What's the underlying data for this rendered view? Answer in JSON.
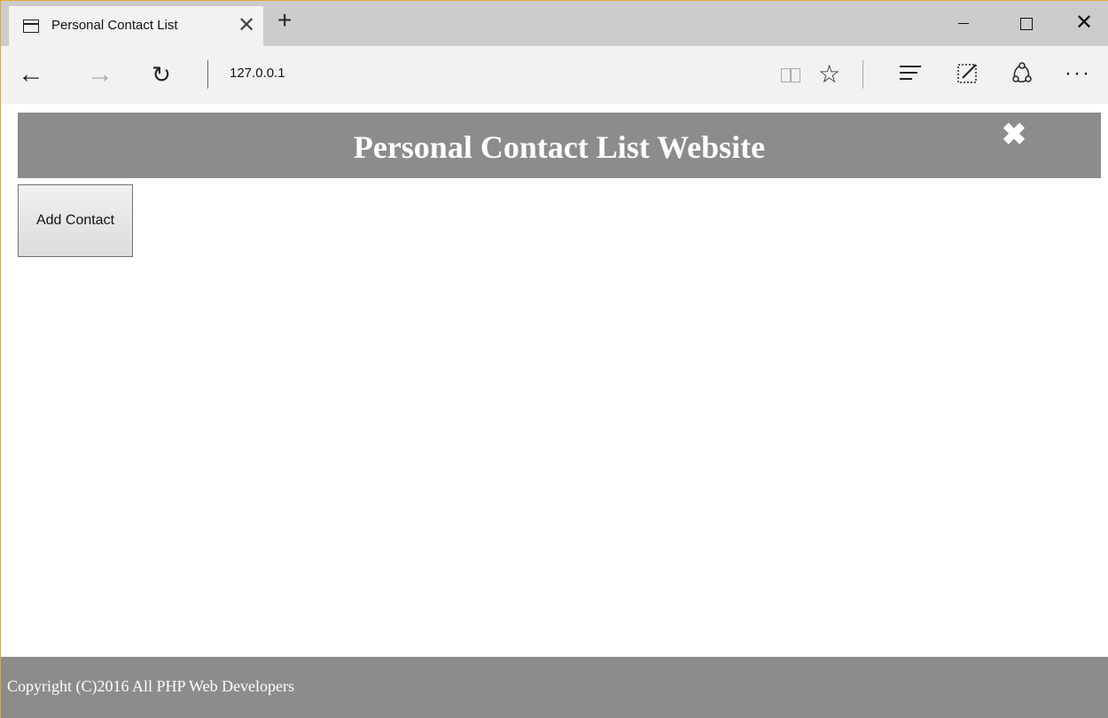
{
  "browser": {
    "tab": {
      "title": "Personal Contact List",
      "close": "✕"
    },
    "new_tab": "+",
    "window_controls": {
      "close": "✕"
    },
    "nav": {
      "back": "←",
      "forward": "→",
      "refresh": "↻"
    },
    "address": "127.0.0.1",
    "toolbar_icons": [
      "reading-view-icon",
      "favorites-star-icon",
      "hub-icon",
      "web-note-icon",
      "share-icon",
      "more-icon"
    ],
    "star": "☆",
    "more": "···"
  },
  "page": {
    "header": {
      "title": "Personal Contact List Website",
      "close": "✖"
    },
    "add_contact_label": "Add Contact",
    "footer": {
      "copyright": "Copyright (C)2016 All PHP Web Developers"
    }
  },
  "colors": {
    "header_bg": "#8c8c8c",
    "footer_bg": "#8c8c8c",
    "tabbar_bg": "#cccccc",
    "navbar_bg": "#f2f2f2",
    "frame_accent": "#e4a82b"
  }
}
